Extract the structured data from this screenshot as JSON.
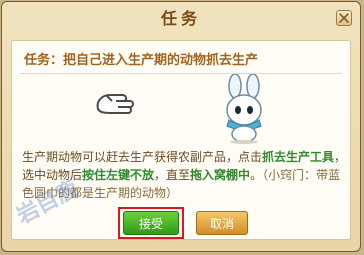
{
  "dialog": {
    "title": "任务",
    "task_heading": "任务：把自己进入生产期的动物抓去生产",
    "description": {
      "p1": "生产期动物可以赶去生产获得农副产品，点击",
      "h1": "抓去生产工具",
      "p2": "，选中动物后",
      "h2": "按住左键不放",
      "p3": "，直至",
      "h3": "拖入窝棚中",
      "p4": "。",
      "tip": "（小窍门：带蓝色圆巾的都是生产期的动物）"
    },
    "buttons": {
      "accept": "接受",
      "cancel": "取消"
    }
  },
  "watermark": {
    "text": "岩目鹿"
  },
  "icons": {
    "close": "close-icon",
    "hand": "grab-hand-icon",
    "rabbit": "rabbit-character-icon"
  },
  "colors": {
    "accent_title": "#a4631c",
    "highlight": "#2e8b2e",
    "accept": "#3aa81e",
    "cancel": "#d99a2b",
    "focus_outline": "#d61a1a"
  }
}
